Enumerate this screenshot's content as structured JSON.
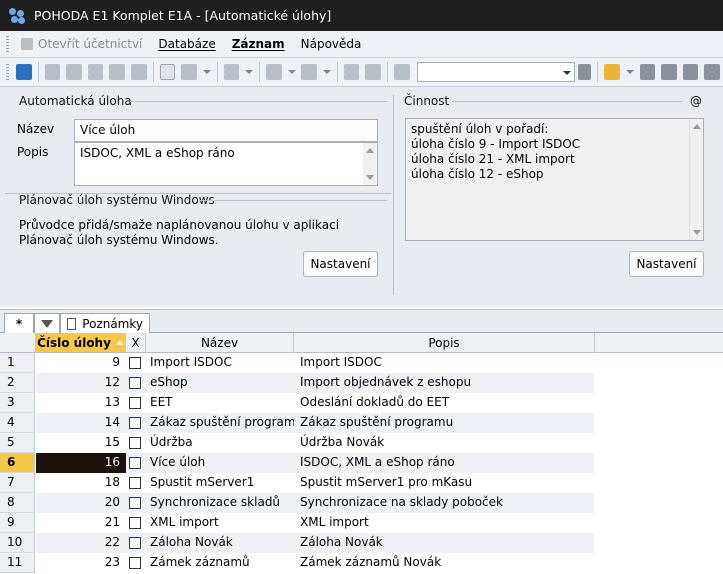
{
  "window": {
    "title": "POHODA E1 Komplet E1A - [Automatické úlohy]"
  },
  "menu": {
    "items": [
      {
        "label": "Otevřít účetnictví",
        "disabled": true
      },
      {
        "label": "Databáze"
      },
      {
        "label": "Záznam",
        "bold": true
      },
      {
        "label": "Nápověda"
      }
    ]
  },
  "panel": {
    "task_section": "Automatická úloha",
    "name_label": "Název",
    "name_value": "Více úloh",
    "desc_label": "Popis",
    "desc_value": "ISDOC, XML a eShop ráno",
    "scheduler_section": "Plánovač úloh systému Windows",
    "scheduler_info_line1": "Průvodce přidá/smaže naplánovanou úlohu v aplikaci",
    "scheduler_info_line2": "Plánovač úloh systému Windows.",
    "settings_button": "Nastavení",
    "activity_section": "Činnost",
    "activity_at": "@",
    "activity_lines": [
      "spuštění úloh v pořadí:",
      "úloha číslo 9 - Import ISDOC",
      "úloha číslo 21 - XML import",
      "úloha číslo 12 - eShop"
    ],
    "activity_button": "Nastavení"
  },
  "tabs": {
    "star": "*",
    "notes": "Poznámky"
  },
  "grid": {
    "columns": {
      "number": "Číslo úlohy",
      "x": "X",
      "name": "Název",
      "desc": "Popis"
    },
    "rows": [
      {
        "idx": "1",
        "number": "9",
        "name": "Import ISDOC",
        "desc": "Import ISDOC"
      },
      {
        "idx": "2",
        "number": "12",
        "name": "eShop",
        "desc": "Import objednávek z eshopu"
      },
      {
        "idx": "3",
        "number": "13",
        "name": "EET",
        "desc": "Odeslání dokladů do EET"
      },
      {
        "idx": "4",
        "number": "14",
        "name": "Zákaz spuštění programu",
        "desc": "Zákaz spuštění programu"
      },
      {
        "idx": "5",
        "number": "15",
        "name": "Údržba",
        "desc": "Údržba Novák"
      },
      {
        "idx": "6",
        "number": "16",
        "name": "Více úloh",
        "desc": "ISDOC, XML a eShop ráno"
      },
      {
        "idx": "7",
        "number": "18",
        "name": "Spustit mServer1",
        "desc": "Spustit mServer1 pro mKasu"
      },
      {
        "idx": "8",
        "number": "20",
        "name": "Synchronizace skladů",
        "desc": "Synchronizace na sklady poboček"
      },
      {
        "idx": "9",
        "number": "21",
        "name": "XML import",
        "desc": "XML import"
      },
      {
        "idx": "10",
        "number": "22",
        "name": "Záloha Novák",
        "desc": "Záloha Novák"
      },
      {
        "idx": "11",
        "number": "23",
        "name": "Zámek záznamů",
        "desc": "Zámek záznamů Novák"
      }
    ],
    "selected_row": 5
  },
  "colors": {
    "accent": "#f7c847",
    "selected": "#1c1008",
    "titlebar": "#1f1f1f"
  }
}
